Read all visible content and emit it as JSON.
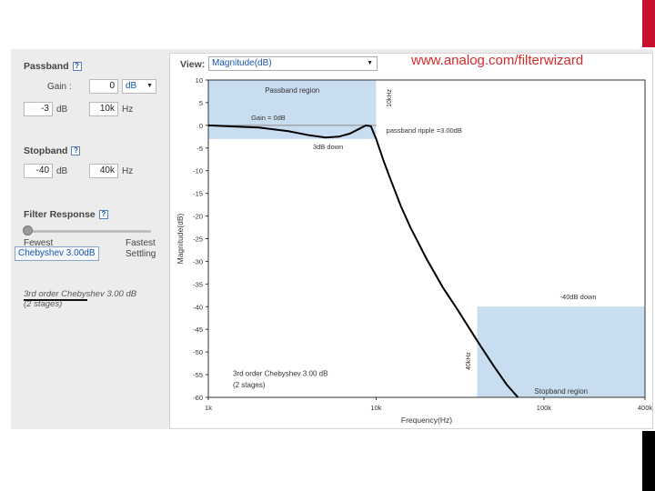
{
  "brand": {
    "bar_color": "#c8102e"
  },
  "passband": {
    "title": "Passband",
    "gain_label": "Gain :",
    "gain_value": "0",
    "gain_unit": "dB",
    "ripple_value": "-3",
    "ripple_unit": "dB",
    "freq_value": "10k",
    "freq_unit": "Hz"
  },
  "stopband": {
    "title": "Stopband",
    "atten_value": "-40",
    "atten_unit": "dB",
    "freq_value": "40k",
    "freq_unit": "Hz"
  },
  "filter_response": {
    "title": "Filter Response",
    "slow_label": "Fewest",
    "fast_label_1": "Fastest",
    "fast_label_2": "Settling",
    "selected_label": "Chebyshev 3.00dB",
    "summary_1": "3rd order Chebyshev 3.00 dB",
    "summary_2": "(2 stages)"
  },
  "view": {
    "label": "View:",
    "selected": "Magnitude(dB)"
  },
  "website": "www.analog.com/filterwizard",
  "help_glyph": "?",
  "chart_data": {
    "type": "line",
    "xlabel": "Frequency(Hz)",
    "ylabel": "Magnitude(dB)",
    "xscale": "log",
    "xlim": [
      1000,
      400000
    ],
    "ylim": [
      -60,
      10
    ],
    "x_ticks": [
      1000,
      10000,
      100000,
      400000
    ],
    "x_tick_labels": [
      "1k",
      "10k",
      "100k",
      "400k"
    ],
    "y_ticks": [
      10,
      5,
      0,
      -5,
      -10,
      -15,
      -20,
      -25,
      -30,
      -35,
      -40,
      -45,
      -50,
      -55,
      -60
    ],
    "y_tick_labels": [
      "10",
      "5",
      "0",
      "-5",
      "-10",
      "-15",
      "-20",
      "-25",
      "-30",
      "-35",
      "-40",
      "-45",
      "-50",
      "-55",
      "-60"
    ],
    "grid": false,
    "series": [
      {
        "x": [
          1000,
          2000,
          3000,
          4000,
          5000,
          6000,
          7000,
          8000,
          8700,
          9300,
          10000,
          11000,
          12000,
          14000,
          16000,
          20000,
          25000,
          30000,
          40000,
          50000,
          60000,
          70000
        ],
        "y": [
          0,
          -0.5,
          -1.3,
          -2.2,
          -2.7,
          -2.5,
          -1.8,
          -0.7,
          0,
          -0.2,
          -3,
          -7.5,
          -11.3,
          -17.7,
          -22.5,
          -29.5,
          -35.8,
          -40.2,
          -47.5,
          -53,
          -57.2,
          -60
        ]
      }
    ],
    "regions": [
      {
        "label": "Passband region",
        "x": [
          1000,
          10000
        ],
        "y": [
          -3,
          10
        ],
        "color": "#c9ddf0"
      },
      {
        "label": "Stopband region",
        "x": [
          40000,
          400000
        ],
        "y": [
          -60,
          -40
        ],
        "color": "#c9ddf0"
      }
    ],
    "annotations": [
      {
        "text": "Gain = 0dB"
      },
      {
        "text": "3dB down"
      },
      {
        "text": "passband ripple =3.00dB"
      },
      {
        "text": "10kHz"
      },
      {
        "text": "-40dB down"
      },
      {
        "text": "40kHz"
      },
      {
        "text": "3rd order Chebyshev 3.00 dB"
      },
      {
        "text": "(2 stages)"
      }
    ]
  }
}
